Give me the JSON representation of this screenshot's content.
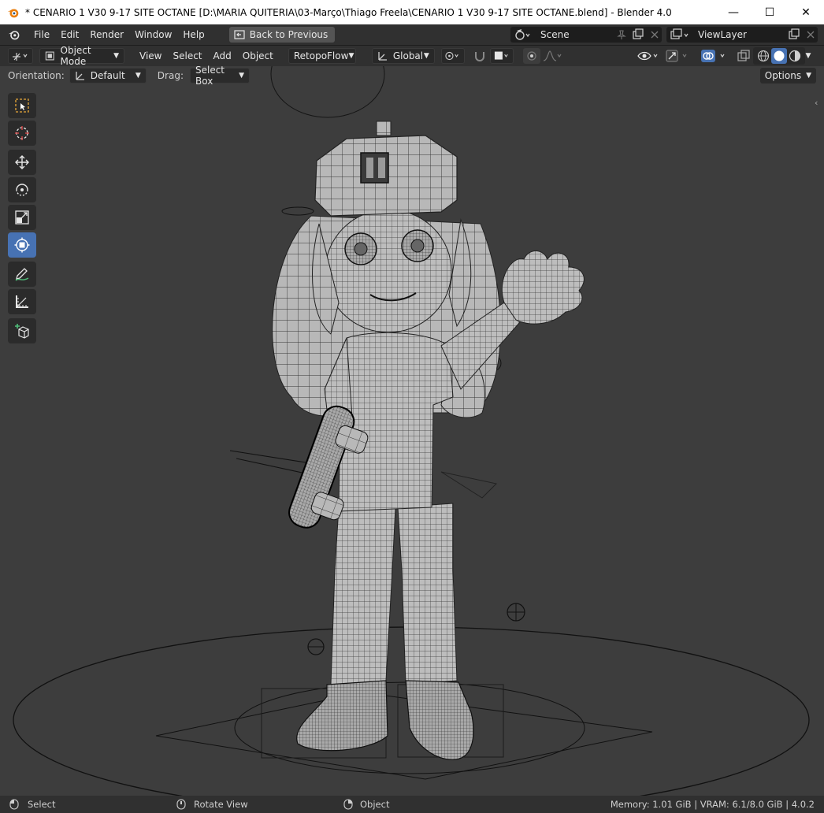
{
  "window": {
    "title": "* CENARIO 1 V30 9-17 SITE OCTANE [D:\\MARIA QUITERIA\\03-Março\\Thiago Freela\\CENARIO 1 V30 9-17 SITE OCTANE.blend] - Blender 4.0",
    "minimize": "—",
    "maximize": "☐",
    "close": "✕"
  },
  "menubar": {
    "items": [
      "File",
      "Edit",
      "Render",
      "Window",
      "Help"
    ],
    "back_button": "Back to Previous",
    "scene_name": "Scene",
    "view_layer": "ViewLayer"
  },
  "header3d": {
    "mode": "Object Mode",
    "menus": [
      "View",
      "Select",
      "Add",
      "Object"
    ],
    "addon_menu": "RetopoFlow",
    "transform_orientation": "Global"
  },
  "tool_settings": {
    "orientation_label": "Orientation:",
    "orientation_value": "Default",
    "drag_label": "Drag:",
    "drag_value": "Select Box",
    "options": "Options"
  },
  "statusbar": {
    "left": "Select",
    "middle": "Rotate View",
    "right": "Object",
    "memory": "Memory: 1.01 GiB | VRAM: 6.1/8.0 GiB | 4.0.2"
  },
  "colors": {
    "accent": "#4772b3",
    "viewport_bg": "#3d3d3d",
    "header_bg": "#303030"
  }
}
